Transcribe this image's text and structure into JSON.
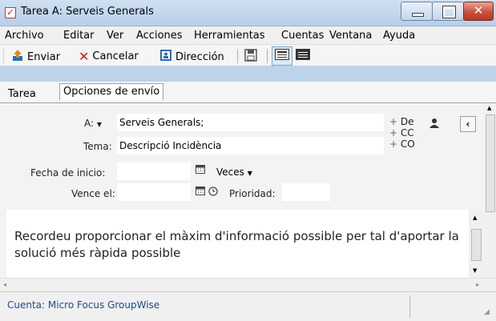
{
  "window": {
    "title": "Tarea A: Serveis Generals"
  },
  "menu": {
    "items": [
      "Archivo",
      "Editar",
      "Ver",
      "Acciones",
      "Herramientas",
      "Cuentas",
      "Ventana",
      "Ayuda"
    ]
  },
  "toolbar": {
    "send_label": "Enviar",
    "cancel_label": "Cancelar",
    "address_label": "Dirección"
  },
  "tabs": [
    {
      "label": "Tarea"
    },
    {
      "label": "Opciones de envío"
    }
  ],
  "form": {
    "to_label": "A:",
    "to_value": "Serveis Generals;",
    "subject_label": "Tema:",
    "subject_value": "Descripció Incidència",
    "start_label": "Fecha de inicio:",
    "start_value": "",
    "times_label": "Veces",
    "due_label": "Vence el:",
    "due_value": "",
    "priority_label": "Prioridad:",
    "priority_value": "",
    "add_from": "De",
    "add_cc": "CC",
    "add_co": "CO"
  },
  "body": {
    "text": "Recordeu proporcionar el màxim d'informació possible per tal d'aportar la solució més ràpida possible"
  },
  "status": {
    "account": "Cuenta: Micro Focus GroupWise"
  },
  "colors": {
    "accent": "#1f4b8b",
    "close": "#c9513b",
    "titlebar": "#bcd3ea"
  }
}
